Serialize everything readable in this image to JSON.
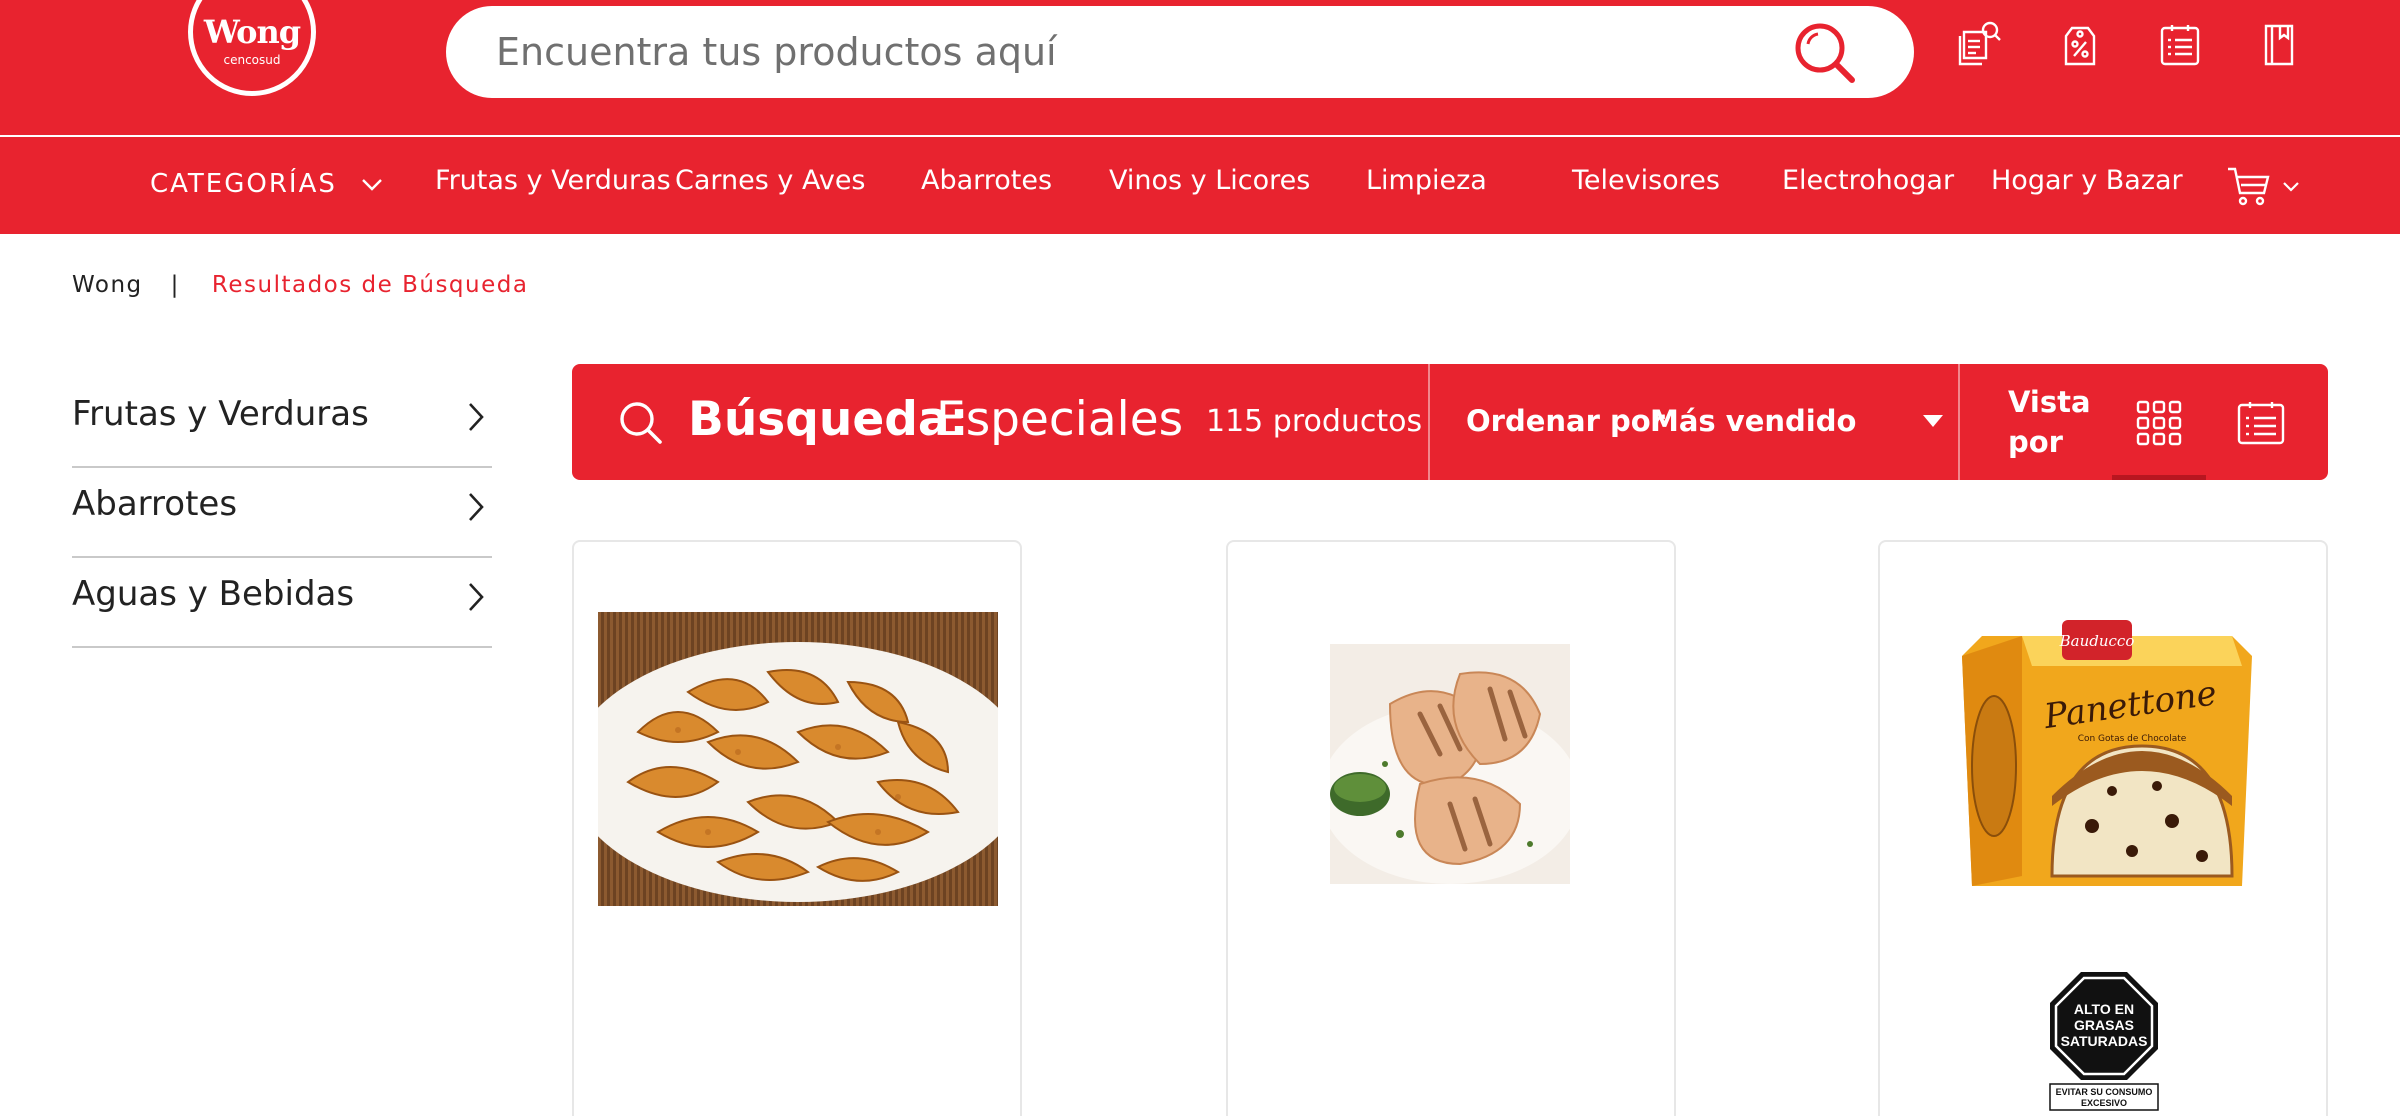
{
  "header": {
    "logo": {
      "brand": "Wong",
      "sub": "cencosud"
    },
    "search": {
      "placeholder": "Encuentra tus productos aquí",
      "value": ""
    },
    "icons": [
      "orders-search-icon",
      "offers-tag-icon",
      "shopping-list-icon",
      "catalog-book-icon"
    ]
  },
  "nav": {
    "categories_label": "CATEGORÍAS",
    "items": [
      "Frutas y Verduras",
      "Carnes y Aves",
      "Abarrotes",
      "Vinos y Licores",
      "Limpieza",
      "Televisores",
      "Electrohogar",
      "Hogar y Bazar"
    ]
  },
  "breadcrumb": {
    "home": "Wong",
    "separator": "|",
    "current": "Resultados de Búsqueda"
  },
  "sidebar": {
    "items": [
      {
        "label": "Frutas y Verduras"
      },
      {
        "label": "Abarrotes"
      },
      {
        "label": "Aguas y Bebidas"
      }
    ]
  },
  "results": {
    "query_label": "Búsqueda:",
    "query": "Especiales",
    "count": "115 productos",
    "sort_label": "Ordenar por",
    "sort_value": "Más vendido",
    "view_label": "Vista por",
    "active_view": "grid"
  },
  "products": [
    {
      "image": "potato-wedges"
    },
    {
      "image": "grilled-chicken"
    },
    {
      "image": "panettone-box",
      "box_brand": "Bauducco",
      "box_title": "Panettone",
      "box_subtitle": "Con Gotas de Chocolate",
      "badge_main": [
        "ALTO EN",
        "GRASAS",
        "SATURADAS"
      ],
      "badge_sub": [
        "EVITAR SU CONSUMO",
        "EXCESIVO"
      ]
    }
  ],
  "colors": {
    "brand_red": "#e8232f",
    "dark_red": "#b81620",
    "white": "#ffffff"
  }
}
